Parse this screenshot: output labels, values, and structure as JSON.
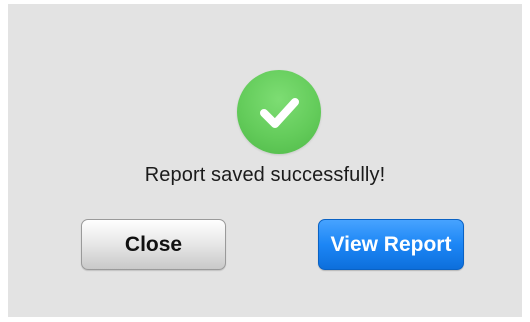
{
  "dialog": {
    "icon": "checkmark-circle-icon",
    "icon_color": "#64cc5b",
    "message": "Report saved successfully!",
    "buttons": {
      "close_label": "Close",
      "view_report_label": "View Report"
    },
    "colors": {
      "background": "#e3e3e3",
      "primary_button": "#1c86f5",
      "secondary_button": "#e6e6e6"
    }
  }
}
